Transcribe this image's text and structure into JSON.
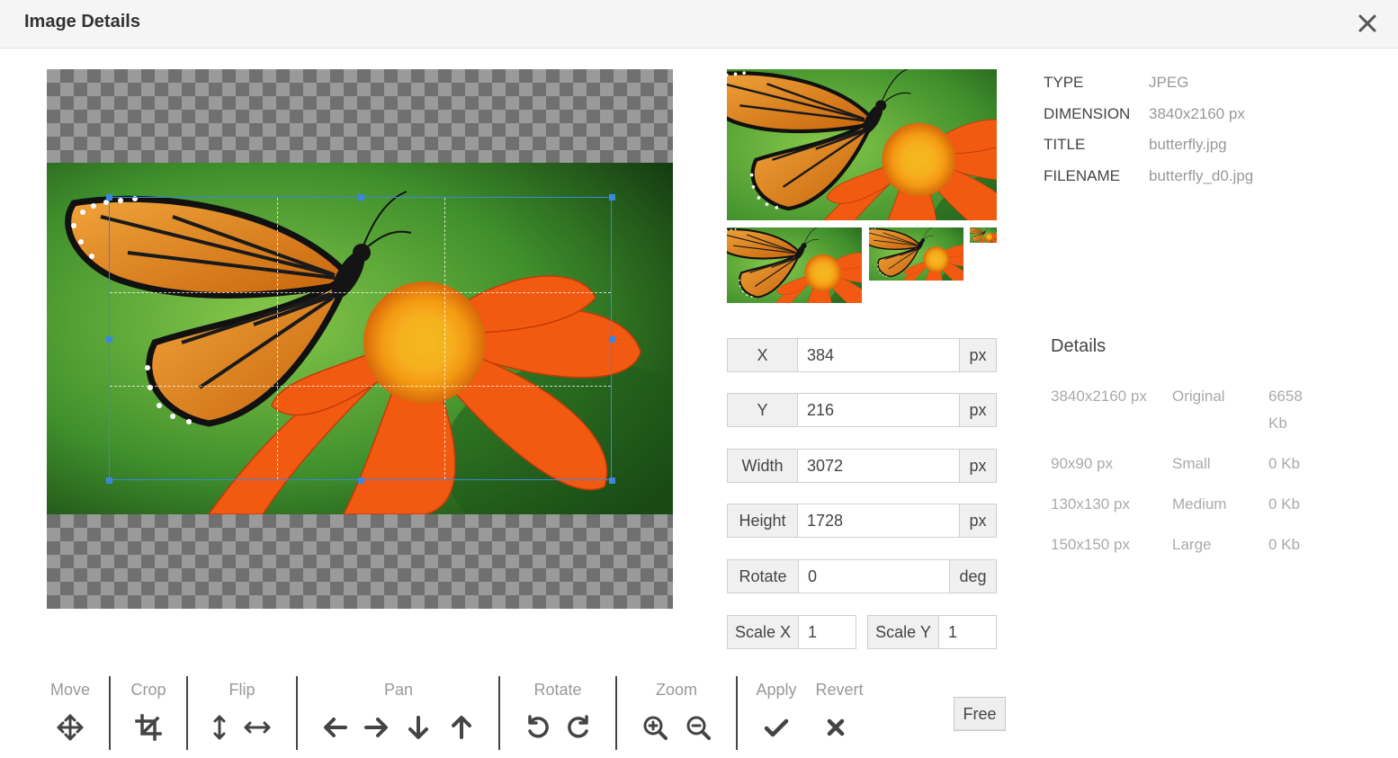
{
  "header": {
    "title": "Image Details",
    "close_icon": "close-icon"
  },
  "info": [
    {
      "key": "TYPE",
      "value": "JPEG"
    },
    {
      "key": "DIMENSION",
      "value": "3840x2160 px"
    },
    {
      "key": "TITLE",
      "value": "butterfly.jpg"
    },
    {
      "key": "FILENAME",
      "value": "butterfly_d0.jpg"
    }
  ],
  "details": {
    "title": "Details",
    "rows": [
      {
        "dimension": "3840x2160 px",
        "name": "Original",
        "size_line1": "6658",
        "size_line2": "Kb"
      },
      {
        "dimension": "90x90 px",
        "name": "Small",
        "size_line1": "0 Kb",
        "size_line2": ""
      },
      {
        "dimension": "130x130 px",
        "name": "Medium",
        "size_line1": "0 Kb",
        "size_line2": ""
      },
      {
        "dimension": "150x150 px",
        "name": "Large",
        "size_line1": "0 Kb",
        "size_line2": ""
      }
    ]
  },
  "fields": {
    "x": {
      "label": "X",
      "value": "384",
      "unit": "px"
    },
    "y": {
      "label": "Y",
      "value": "216",
      "unit": "px"
    },
    "width": {
      "label": "Width",
      "value": "3072",
      "unit": "px"
    },
    "height": {
      "label": "Height",
      "value": "1728",
      "unit": "px"
    },
    "rotate": {
      "label": "Rotate",
      "value": "0",
      "unit": "deg"
    },
    "scale_x": {
      "label": "Scale X",
      "value": "1"
    },
    "scale_y": {
      "label": "Scale Y",
      "value": "1"
    }
  },
  "toolbar": {
    "move": "Move",
    "crop": "Crop",
    "flip": "Flip",
    "pan": "Pan",
    "rotate": "Rotate",
    "zoom": "Zoom",
    "apply": "Apply",
    "revert": "Revert",
    "aspect_button": "Free"
  },
  "icons": {
    "move": "move-arrows-icon",
    "crop": "crop-icon",
    "flip_vertical": "flip-vertical-icon",
    "flip_horizontal": "flip-horizontal-icon",
    "pan_left": "arrow-left-icon",
    "pan_right": "arrow-right-icon",
    "pan_down": "arrow-down-icon",
    "pan_up": "arrow-up-icon",
    "rotate_left": "rotate-left-icon",
    "rotate_right": "rotate-right-icon",
    "zoom_in": "zoom-in-icon",
    "zoom_out": "zoom-out-icon",
    "apply": "checkmark-icon",
    "revert": "x-icon"
  },
  "colors": {
    "crop_border": "#3b87e0",
    "header_bg": "#f5f5f5",
    "icon": "#444444",
    "muted_text": "#999999"
  }
}
